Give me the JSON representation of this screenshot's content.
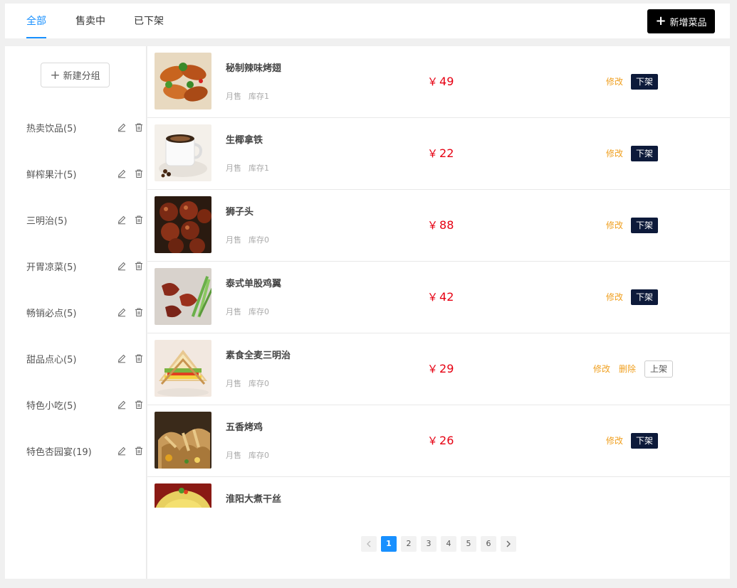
{
  "tabs": [
    {
      "label": "全部",
      "active": true
    },
    {
      "label": "售卖中",
      "active": false
    },
    {
      "label": "已下架",
      "active": false
    }
  ],
  "header": {
    "add_dish_label": "新增菜品",
    "add_icon": "plus-icon"
  },
  "sidebar": {
    "new_group_label": "新建分组",
    "groups": [
      {
        "label": "热卖饮品(5)"
      },
      {
        "label": "鲜榨果汁(5)"
      },
      {
        "label": "三明治(5)"
      },
      {
        "label": "开胃凉菜(5)"
      },
      {
        "label": "畅销必点(5)"
      },
      {
        "label": "甜品点心(5)"
      },
      {
        "label": "特色小吃(5)"
      },
      {
        "label": "特色杏园宴(19)"
      }
    ],
    "edit_icon": "pencil-icon",
    "delete_icon": "trash-icon"
  },
  "dishes": [
    {
      "name": "秘制辣味烤翅",
      "monthly_sales_label": "月售",
      "stock_label": "库存1",
      "price_symbol": "￥",
      "price": "49",
      "status": "on",
      "actions": {
        "edit": "修改",
        "toggle": "下架"
      }
    },
    {
      "name": "生椰拿铁",
      "monthly_sales_label": "月售",
      "stock_label": "库存1",
      "price_symbol": "￥",
      "price": "22",
      "status": "on",
      "actions": {
        "edit": "修改",
        "toggle": "下架"
      }
    },
    {
      "name": "狮子头",
      "monthly_sales_label": "月售",
      "stock_label": "库存0",
      "price_symbol": "￥",
      "price": "88",
      "status": "on",
      "actions": {
        "edit": "修改",
        "toggle": "下架"
      }
    },
    {
      "name": "泰式单股鸡翼",
      "monthly_sales_label": "月售",
      "stock_label": "库存0",
      "price_symbol": "￥",
      "price": "42",
      "status": "on",
      "actions": {
        "edit": "修改",
        "toggle": "下架"
      }
    },
    {
      "name": "素食全麦三明治",
      "monthly_sales_label": "月售",
      "stock_label": "库存0",
      "price_symbol": "￥",
      "price": "29",
      "status": "off",
      "actions": {
        "edit": "修改",
        "delete": "删除",
        "toggle": "上架"
      }
    },
    {
      "name": "五香烤鸡",
      "monthly_sales_label": "月售",
      "stock_label": "库存0",
      "price_symbol": "￥",
      "price": "26",
      "status": "on",
      "actions": {
        "edit": "修改",
        "toggle": "下架"
      }
    },
    {
      "name": "淮阳大煮干丝",
      "monthly_sales_label": "",
      "stock_label": "",
      "price_symbol": "",
      "price": "",
      "status": "on",
      "actions": {
        "edit": "",
        "toggle": ""
      }
    }
  ],
  "pagination": {
    "prev_icon": "chevron-left-icon",
    "next_icon": "chevron-right-icon",
    "pages": [
      "1",
      "2",
      "3",
      "4",
      "5",
      "6"
    ],
    "current": "1"
  },
  "colors": {
    "accent": "#1890ff",
    "price": "#e60012",
    "action_link": "#f0a020",
    "off_button": "#0d1a3a"
  }
}
